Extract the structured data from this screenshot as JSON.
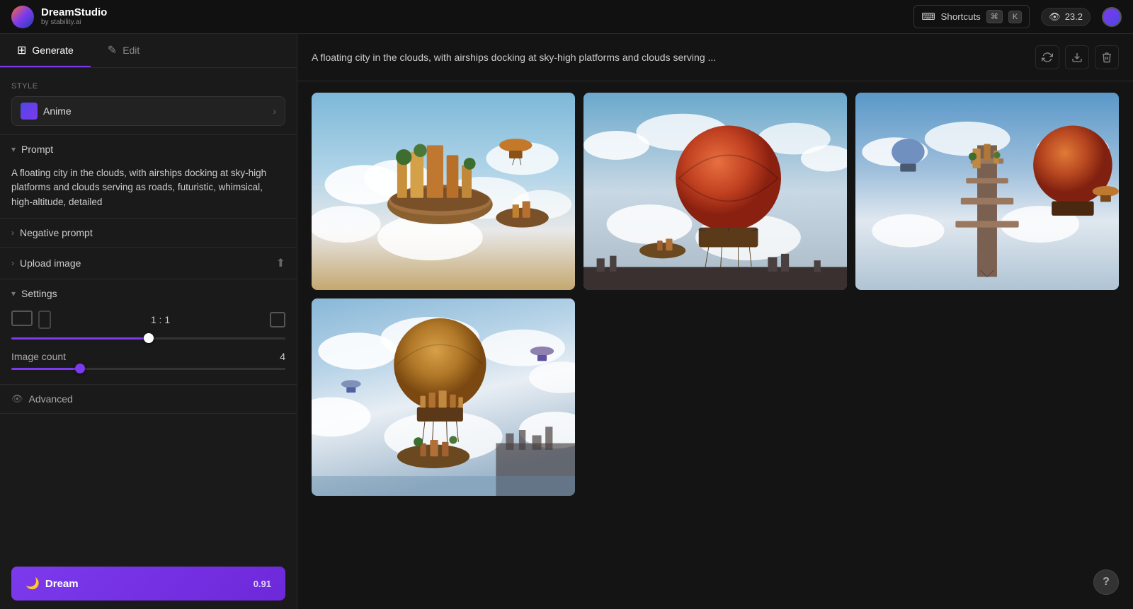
{
  "app": {
    "name": "DreamStudio",
    "subtitle": "by stability.ai"
  },
  "topbar": {
    "shortcuts_label": "Shortcuts",
    "kbd1": "⌘",
    "kbd2": "K",
    "credits": "23.2",
    "visibility_icon": "👁"
  },
  "nav": {
    "generate_label": "Generate",
    "edit_label": "Edit"
  },
  "sidebar": {
    "style_label": "Style",
    "style_value": "Anime",
    "prompt_label": "Prompt",
    "prompt_text": "A floating city in the clouds, with airships docking at sky-high platforms and clouds serving as roads, futuristic, whimsical, high-altitude, detailed",
    "negative_prompt_label": "Negative prompt",
    "upload_image_label": "Upload image",
    "settings_label": "Settings",
    "aspect_ratio_value": "1 : 1",
    "image_count_label": "Image count",
    "image_count_value": "4",
    "advanced_label": "Advanced",
    "dream_label": "Dream",
    "dream_cost": "0.91"
  },
  "content": {
    "title": "A floating city in the clouds, with airships docking at sky-high platforms and clouds serving ...",
    "images": [
      {
        "id": 1,
        "type": "top-left"
      },
      {
        "id": 2,
        "type": "top-center"
      },
      {
        "id": 3,
        "type": "top-right"
      },
      {
        "id": 4,
        "type": "bottom-left"
      }
    ]
  },
  "help": {
    "label": "?"
  }
}
